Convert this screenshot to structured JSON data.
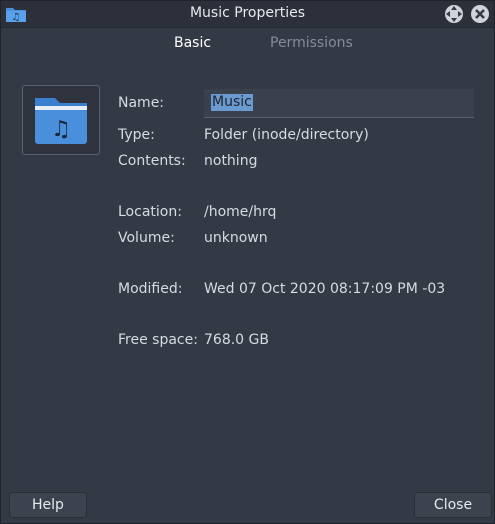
{
  "window": {
    "title": "Music Properties"
  },
  "tabs": [
    {
      "label": "Basic",
      "active": true
    },
    {
      "label": "Permissions",
      "active": false
    }
  ],
  "icon": {
    "name": "music-folder-icon",
    "color": "#4a8fdc"
  },
  "fields": {
    "name_label": "Name:",
    "name_value": "Music",
    "type_label": "Type:",
    "type_value": "Folder (inode/directory)",
    "contents_label": "Contents:",
    "contents_value": "nothing",
    "location_label": "Location:",
    "location_value": "/home/hrq",
    "volume_label": "Volume:",
    "volume_value": "unknown",
    "modified_label": "Modified:",
    "modified_value": "Wed 07 Oct 2020 08:17:09 PM -03",
    "free_space_label": "Free space:",
    "free_space_value": "768.0 GB"
  },
  "buttons": {
    "help": "Help",
    "close": "Close"
  },
  "colors": {
    "background": "#343a45",
    "titlebar": "#2b303a",
    "selection": "#6a9ad0",
    "folder": "#4a8fdc"
  }
}
